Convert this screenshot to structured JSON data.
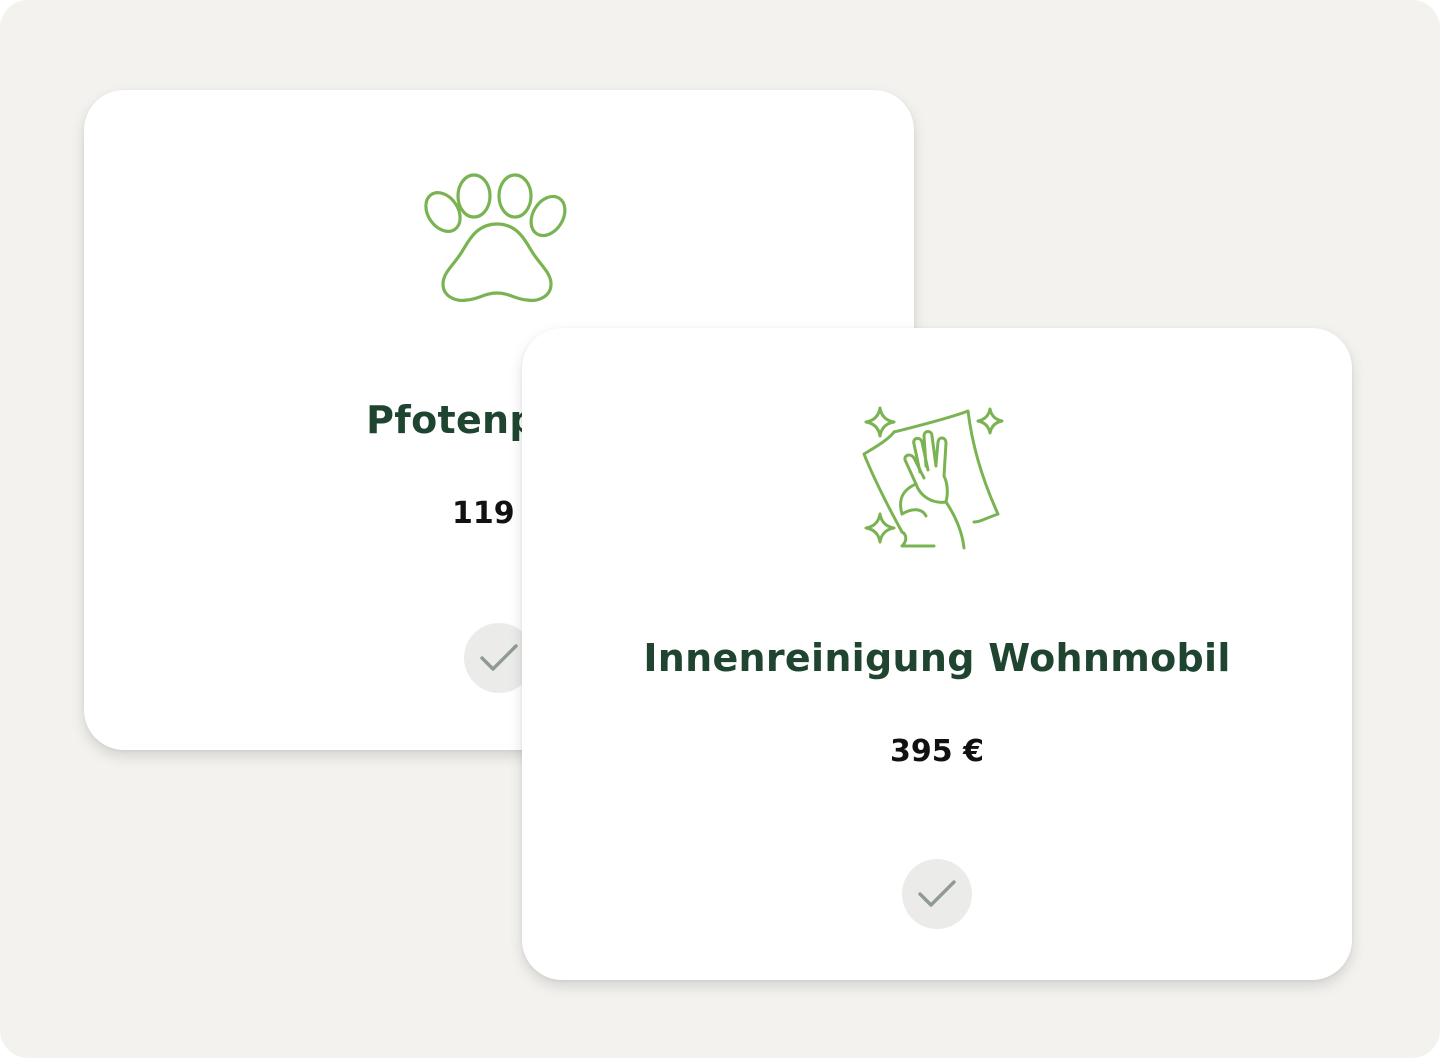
{
  "cards": [
    {
      "title": "Pfotenpaket",
      "price": "119 €",
      "icon": "paw-icon",
      "selected": false
    },
    {
      "title": "Innenreinigung Wohnmobil",
      "price": "395 €",
      "icon": "cleaning-hand-icon",
      "selected": false
    }
  ],
  "colors": {
    "background": "#f3f2ee",
    "card": "#ffffff",
    "accent_green": "#7ab351",
    "title_green": "#1f4531",
    "price_text": "#111111",
    "check_bg": "#ebebea",
    "check_mark": "#8e9a92"
  }
}
